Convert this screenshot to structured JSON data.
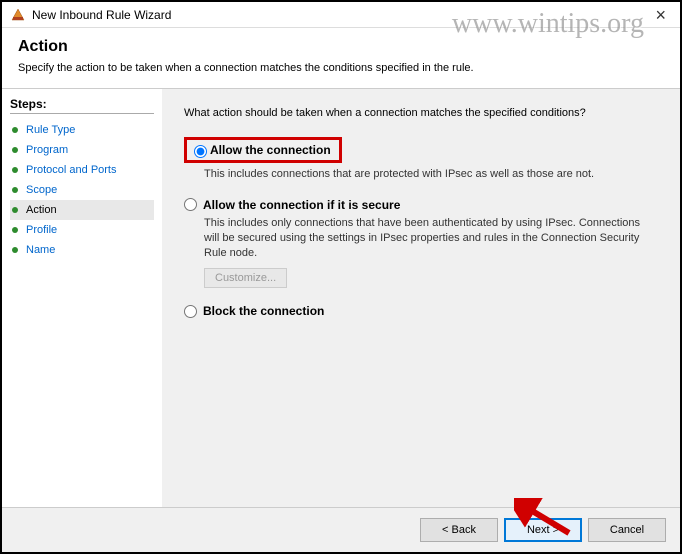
{
  "window": {
    "title": "New Inbound Rule Wizard"
  },
  "header": {
    "heading": "Action",
    "subtext": "Specify the action to be taken when a connection matches the conditions specified in the rule."
  },
  "sidebar": {
    "label": "Steps:",
    "items": [
      {
        "label": "Rule Type",
        "current": false
      },
      {
        "label": "Program",
        "current": false
      },
      {
        "label": "Protocol and Ports",
        "current": false
      },
      {
        "label": "Scope",
        "current": false
      },
      {
        "label": "Action",
        "current": true
      },
      {
        "label": "Profile",
        "current": false
      },
      {
        "label": "Name",
        "current": false
      }
    ]
  },
  "main": {
    "question": "What action should be taken when a connection matches the specified conditions?",
    "options": {
      "allow": {
        "label": "Allow the connection",
        "desc": "This includes connections that are protected with IPsec as well as those are not."
      },
      "allow_secure": {
        "label": "Allow the connection if it is secure",
        "desc": "This includes only connections that have been authenticated by using IPsec. Connections will be secured using the settings in IPsec properties and rules in the Connection Security Rule node.",
        "customize": "Customize..."
      },
      "block": {
        "label": "Block the connection"
      }
    }
  },
  "footer": {
    "back": "< Back",
    "next": "Next >",
    "cancel": "Cancel"
  },
  "watermark": "www.wintips.org"
}
